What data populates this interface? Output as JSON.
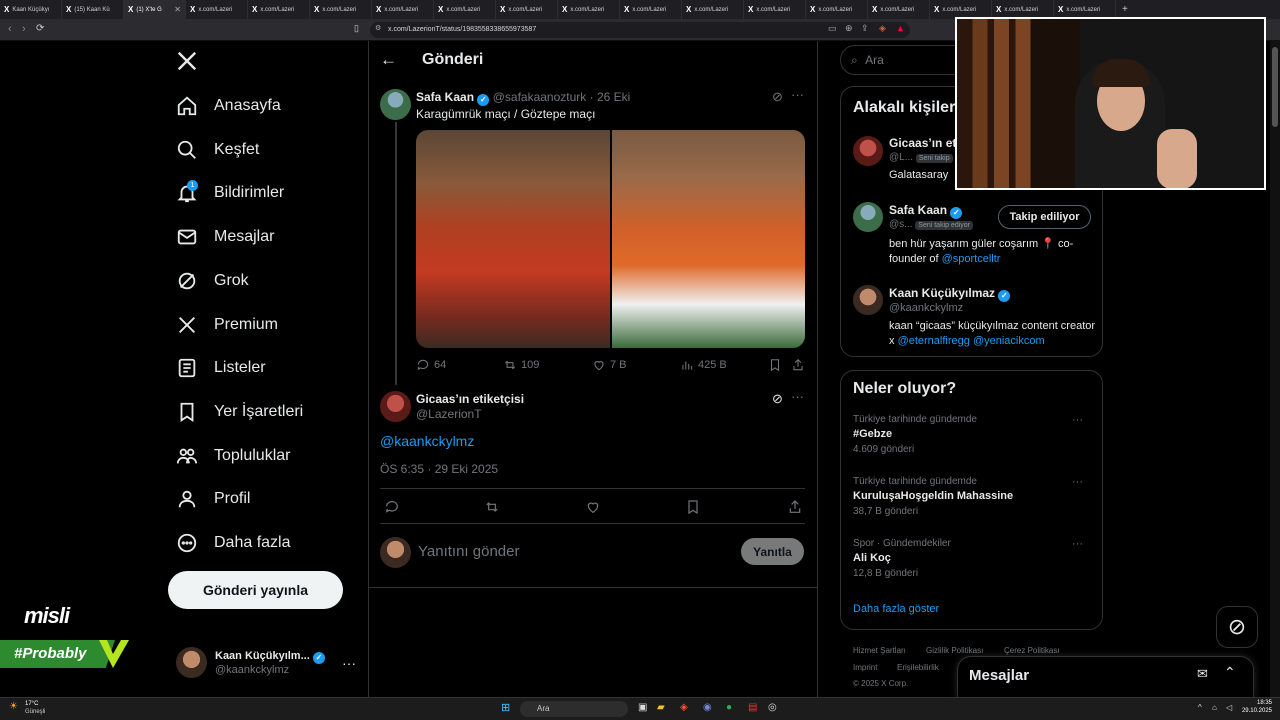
{
  "browser": {
    "tabs": [
      {
        "label": "Kaan Küçükyı",
        "active": false
      },
      {
        "label": "(15) Kaan Kü",
        "active": false
      },
      {
        "label": "(1) X'te G",
        "active": true
      },
      {
        "label": "x.com/Lazeri",
        "active": false
      },
      {
        "label": "x.com/Lazeri",
        "active": false
      },
      {
        "label": "x.com/Lazeri",
        "active": false
      },
      {
        "label": "x.com/Lazeri",
        "active": false
      },
      {
        "label": "x.com/Lazeri",
        "active": false
      },
      {
        "label": "x.com/Lazeri",
        "active": false
      },
      {
        "label": "x.com/Lazeri",
        "active": false
      },
      {
        "label": "x.com/Lazeri",
        "active": false
      },
      {
        "label": "x.com/Lazeri",
        "active": false
      },
      {
        "label": "x.com/Lazeri",
        "active": false
      },
      {
        "label": "x.com/Lazeri",
        "active": false
      },
      {
        "label": "x.com/Lazeri",
        "active": false
      },
      {
        "label": "x.com/Lazeri",
        "active": false
      },
      {
        "label": "x.com/Lazeri",
        "active": false
      },
      {
        "label": "x.com/Lazeri",
        "active": false
      }
    ],
    "url": "x.com/LazerionT/status/1983558338655973587",
    "new_tab": "+"
  },
  "nav": {
    "items": [
      {
        "label": "Anasayfa",
        "icon": "home-icon"
      },
      {
        "label": "Keşfet",
        "icon": "search-icon"
      },
      {
        "label": "Bildirimler",
        "icon": "bell-icon",
        "badge": "1"
      },
      {
        "label": "Mesajlar",
        "icon": "mail-icon"
      },
      {
        "label": "Grok",
        "icon": "grok-icon"
      },
      {
        "label": "Premium",
        "icon": "x-logo-icon"
      },
      {
        "label": "Listeler",
        "icon": "list-icon"
      },
      {
        "label": "Yer İşaretleri",
        "icon": "bookmark-icon"
      },
      {
        "label": "Topluluklar",
        "icon": "people-icon"
      },
      {
        "label": "Profil",
        "icon": "person-icon"
      },
      {
        "label": "Daha fazla",
        "icon": "more-circle-icon"
      }
    ],
    "post_button": "Gönderi yayınla",
    "account": {
      "name": "Kaan Küçükyılm...",
      "handle": "@kaankckylmz"
    }
  },
  "center": {
    "header_title": "Gönderi",
    "quoted": {
      "name": "Safa Kaan",
      "handle": "@safakaanozturk",
      "date": "· 26 Eki",
      "text": "Karagümrük maçı / Göztepe maçı",
      "replies": "64",
      "retweets": "109",
      "likes": "7 B",
      "views": "425 B"
    },
    "main": {
      "name": "Gicaas’ın etiketçisi",
      "handle": "@LazerionT",
      "text": "@kaankckylmz",
      "timestamp": "ÖS 6:35 · 29 Eki 2025"
    },
    "reply": {
      "placeholder": "Yanıtını gönder",
      "button": "Yanıtla"
    }
  },
  "right": {
    "search_placeholder": "Ara",
    "related": {
      "title": "Alakalı kişiler",
      "people": [
        {
          "name": "Gicaas’ın eti",
          "handle": "@L...",
          "follows_you": "Seni takip",
          "bio": "Galatasaray"
        },
        {
          "name": "Safa Kaan",
          "handle": "@s...",
          "follows_you": "Seni takip ediyor",
          "button": "Takip ediliyor",
          "bio_text": "ben hür yaşarım güler coşarım 📍 co-founder of ",
          "bio_link": "@sportcelltr"
        },
        {
          "name": "Kaan Küçükyılmaz",
          "handle": "@kaankckylmz",
          "bio_text": "kaan “gicaas” küçükyılmaz content creator x ",
          "bio_link1": "@eternalfiregg",
          "bio_link2": "@yeniacikcom"
        }
      ]
    },
    "trends": {
      "title": "Neler oluyor?",
      "items": [
        {
          "context": "Türkiye tarihinde gündemde",
          "name": "#Gebze",
          "count": "4.609 gönderi"
        },
        {
          "context": "Türkiye tarihinde gündemde",
          "name": "KuruluşaHoşgeldin Mahassine",
          "count": "38,7 B gönderi"
        },
        {
          "context": "Spor · Gündemdekiler",
          "name": "Ali Koç",
          "count": "12,8 B gönderi"
        }
      ],
      "show_more": "Daha fazla göster"
    },
    "footer": {
      "links": [
        "Hizmet Şartları",
        "Gizlilik Politikası",
        "Çerez Politikası",
        "Imprint",
        "Erişilebilirlik"
      ],
      "copyright": "© 2025 X Corp."
    },
    "messages_drawer": "Mesajlar"
  },
  "overlay": {
    "sponsor_logo": "misli",
    "hashtag": "#Probably"
  },
  "taskbar": {
    "weather_temp": "17°C",
    "weather_desc": "Güneşli",
    "search": "Ara",
    "time": "18:35",
    "date": "29.10.2025"
  }
}
